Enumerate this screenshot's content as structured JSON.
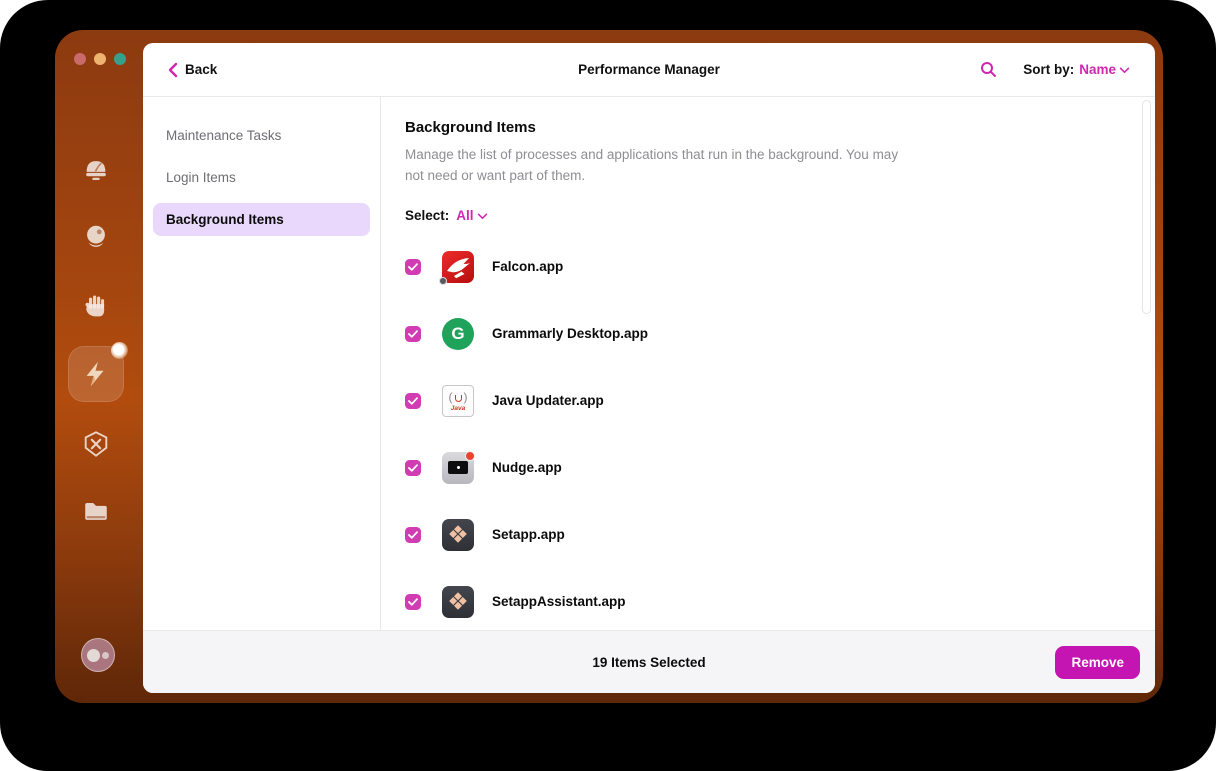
{
  "colors": {
    "accent_pink": "#cf27b0",
    "remove_button": "#c414b2",
    "nav_selected_bg": "#e9d8fb",
    "window_orange_top": "#8c3a10",
    "window_orange_mid": "#b24c0e",
    "traffic_close": "#c96b6b",
    "traffic_min": "#eeb36e",
    "traffic_zoom": "#35a18a"
  },
  "titlebar": {
    "back_label": "Back",
    "title": "Performance Manager",
    "sort_label": "Sort by:",
    "sort_value": "Name"
  },
  "dock": {
    "icons": [
      "cleanup-module",
      "smart-scan-orb",
      "protection-hand",
      "performance-bolt",
      "applications-badge",
      "files-folder",
      "assistant"
    ]
  },
  "nav": {
    "items": [
      {
        "label": "Maintenance Tasks",
        "selected": false
      },
      {
        "label": "Login Items",
        "selected": false
      },
      {
        "label": "Background Items",
        "selected": true
      }
    ]
  },
  "panel": {
    "heading": "Background Items",
    "description": "Manage the list of processes and applications that run in the background. You may not need or want part of them.",
    "select_label": "Select:",
    "select_value": "All",
    "items": [
      {
        "name": "Falcon.app",
        "checked": true
      },
      {
        "name": "Grammarly Desktop.app",
        "checked": true,
        "icon_letter": "G"
      },
      {
        "name": "Java Updater.app",
        "checked": true,
        "icon_paren_l": "(",
        "icon_paren_r": ")",
        "icon_text": "Java"
      },
      {
        "name": "Nudge.app",
        "checked": true
      },
      {
        "name": "Setapp.app",
        "checked": true
      },
      {
        "name": "SetappAssistant.app",
        "checked": true
      }
    ]
  },
  "footer": {
    "status": "19 Items Selected",
    "remove_label": "Remove"
  }
}
